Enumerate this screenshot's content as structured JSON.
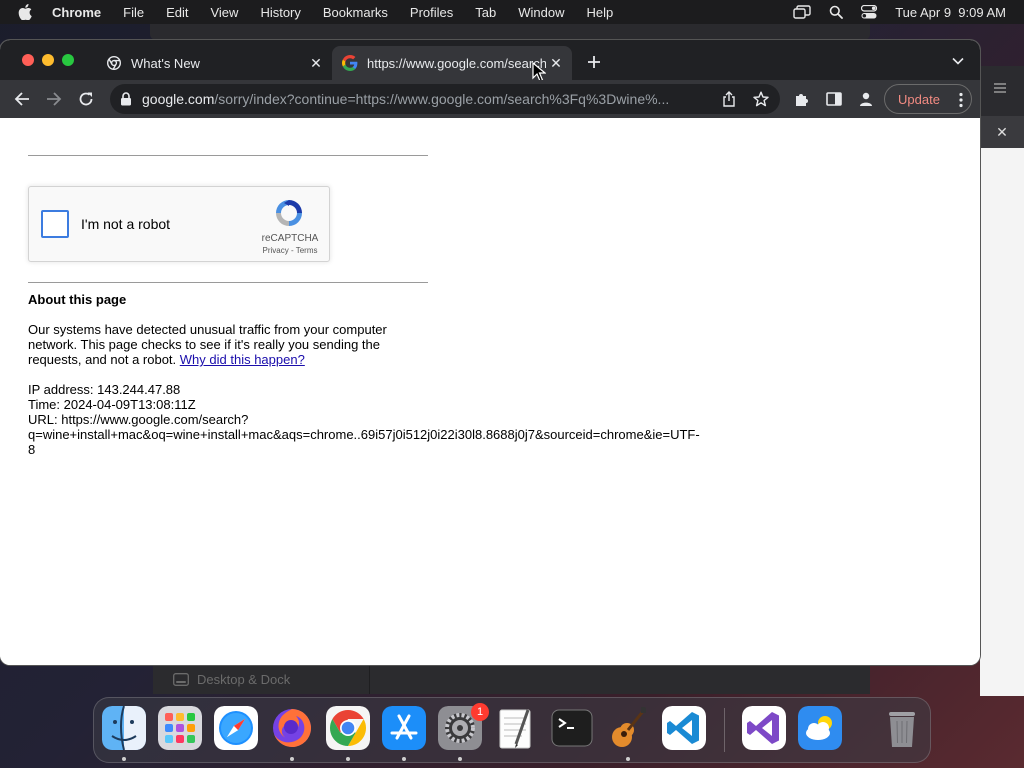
{
  "menubar": {
    "app_name": "Chrome",
    "menus": [
      "File",
      "Edit",
      "View",
      "History",
      "Bookmarks",
      "Profiles",
      "Tab",
      "Window",
      "Help"
    ],
    "datetime": "Tue Apr 9  9:09 AM"
  },
  "browser": {
    "tabs": [
      {
        "title": "What's New",
        "active": false
      },
      {
        "title": "https://www.google.com/search",
        "active": true
      }
    ],
    "address_host": "google.com",
    "address_path": "/sorry/index?continue=https://www.google.com/search%3Fq%3Dwine%...",
    "update_label": "Update"
  },
  "page": {
    "captcha_label": "I'm not a robot",
    "captcha_brand": "reCAPTCHA",
    "captcha_terms": "Privacy - Terms",
    "about_heading": "About this page",
    "about_text": "Our systems have detected unusual traffic from your computer network. This page checks to see if it's really you sending the requests, and not a robot. ",
    "about_link": "Why did this happen?",
    "ip_line": "IP address: 143.244.47.88",
    "time_line": "Time: 2024-04-09T13:08:11Z",
    "url_line1": "URL: https://www.google.com/search?",
    "url_line2": "q=wine+install+mac&oq=wine+install+mac&aqs=chrome..69i57j0i512j0i22i30l8.8688j0j7&sourceid=chrome&ie=UTF-",
    "url_line3": "8"
  },
  "background": {
    "bottom_window_label": "Desktop & Dock"
  },
  "dock": {
    "apps": [
      "Finder",
      "Launchpad",
      "Safari",
      "Firefox",
      "Chrome",
      "App Store",
      "System Settings",
      "TextEdit",
      "Terminal",
      "GarageBand",
      "Visual Studio Code",
      "Visual Studio",
      "Weather",
      "Trash"
    ],
    "system_settings_badge": "1"
  },
  "colors": {
    "link": "#1a0dab",
    "captcha_checkbox": "#3c7ce0",
    "update_text": "#f28b82"
  }
}
